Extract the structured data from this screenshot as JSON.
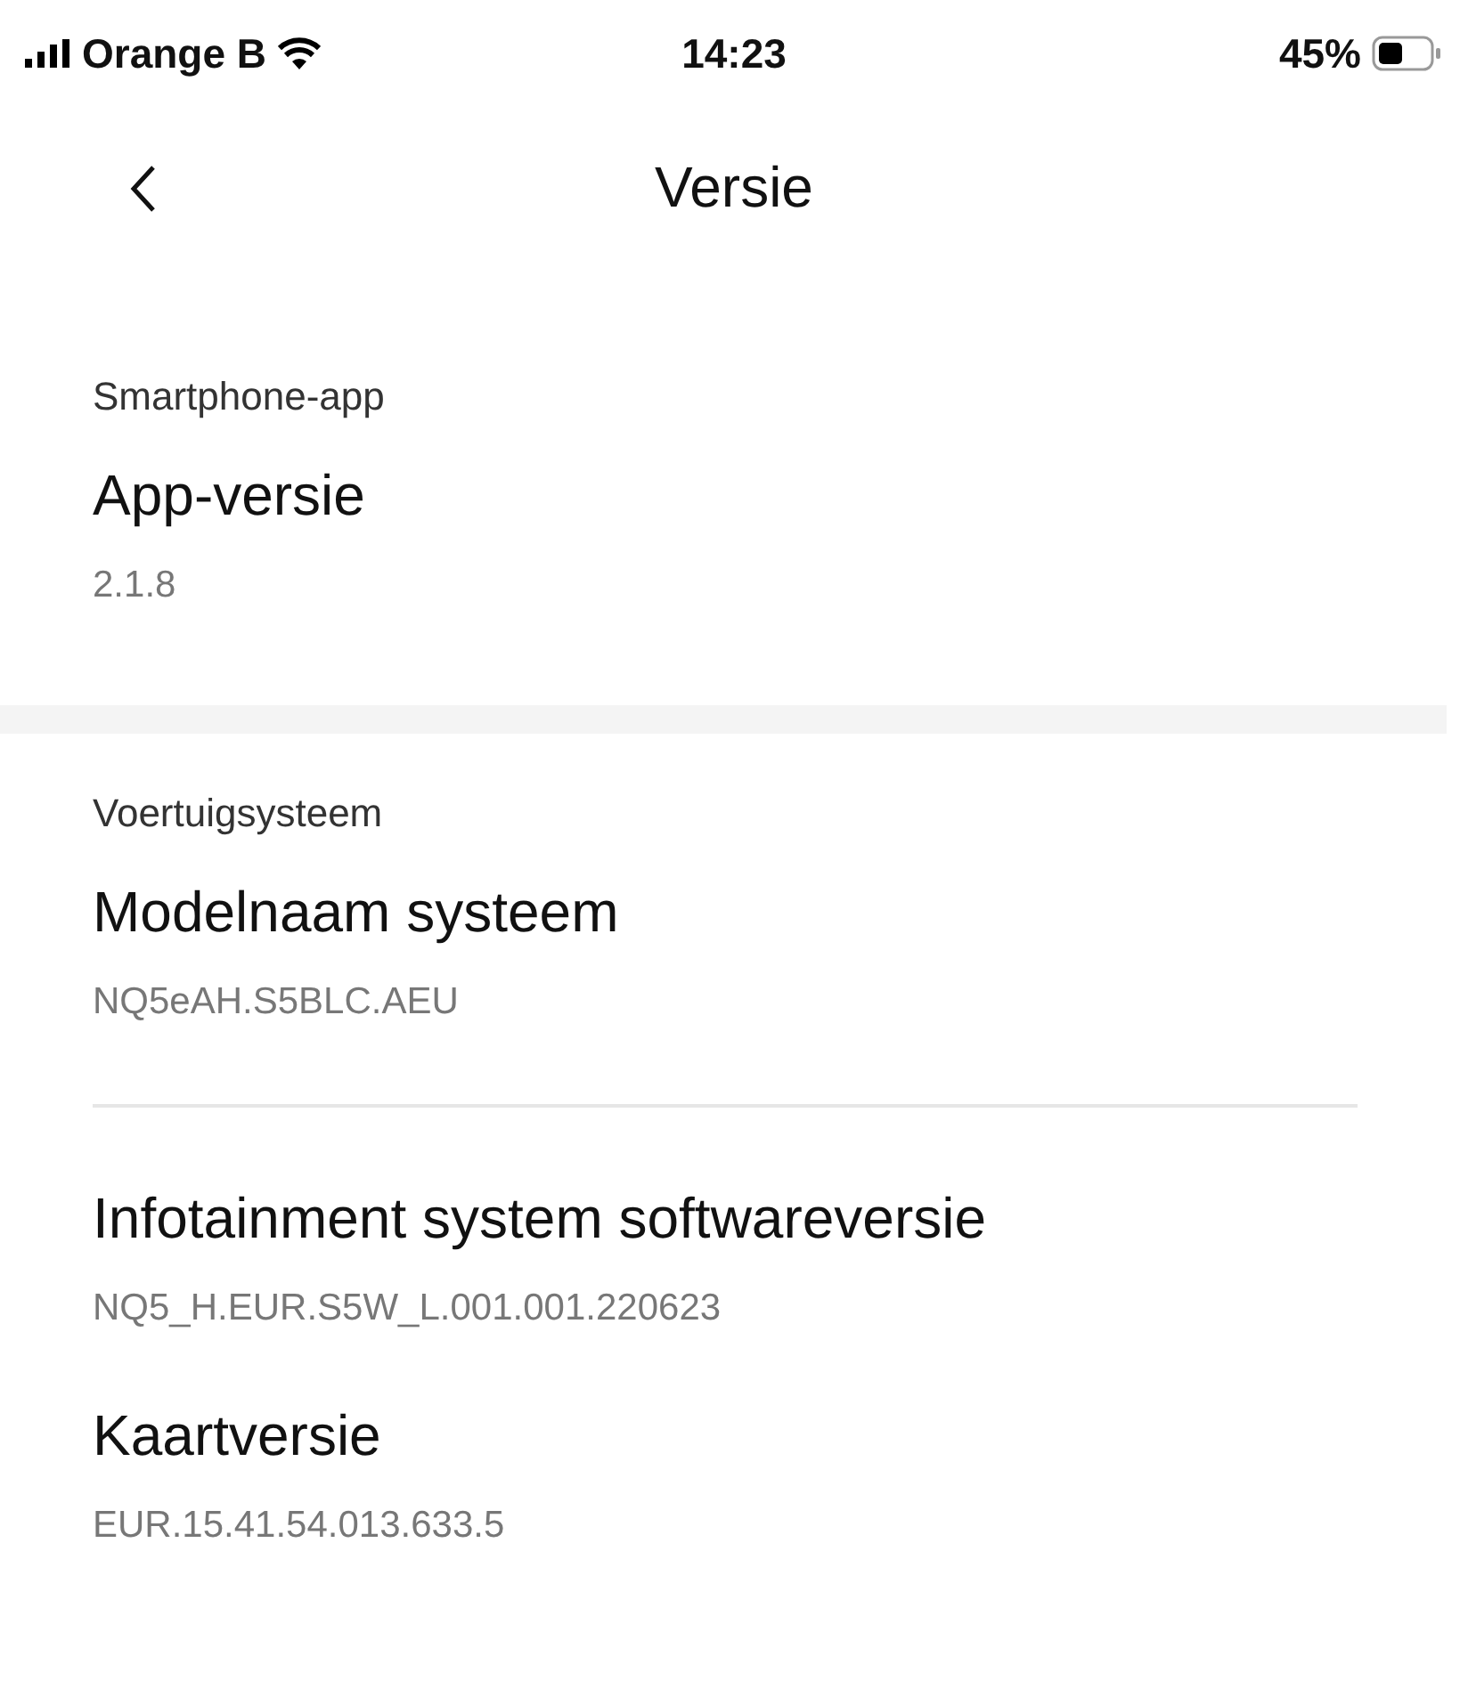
{
  "status_bar": {
    "carrier": "Orange B",
    "time": "14:23",
    "battery": "45%"
  },
  "header": {
    "title": "Versie"
  },
  "sections": [
    {
      "heading": "Smartphone-app",
      "groups": [
        [
          {
            "title": "App-versie",
            "value": "2.1.8"
          }
        ]
      ]
    },
    {
      "heading": "Voertuigsysteem",
      "groups": [
        [
          {
            "title": "Modelnaam systeem",
            "value": "NQ5eAH.S5BLC.AEU"
          }
        ],
        [
          {
            "title": "Infotainment system softwareversie",
            "value": "NQ5_H.EUR.S5W_L.001.001.220623"
          },
          {
            "title": "Kaartversie",
            "value": "EUR.15.41.54.013.633.5"
          }
        ]
      ]
    }
  ]
}
